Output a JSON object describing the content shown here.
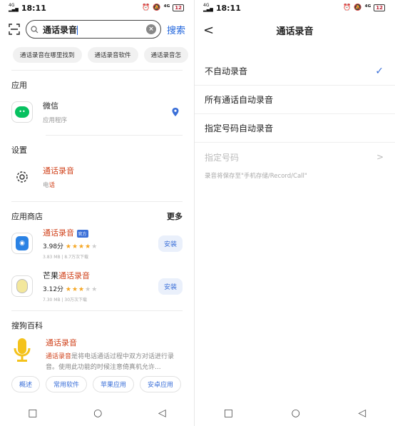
{
  "left": {
    "status": {
      "time": "18:11",
      "signal": "4G",
      "alarm_icon": "alarm-icon",
      "battery": "12"
    },
    "search": {
      "query": "通话录音",
      "clear_label": "×",
      "search_label": "搜索"
    },
    "chips": [
      "通话录音在哪里找到",
      "通话录音软件",
      "通话录音怎"
    ],
    "apps_section": {
      "title": "应用",
      "item": {
        "name": "微信",
        "sub": "应用程序"
      }
    },
    "settings_section": {
      "title": "设置",
      "item": {
        "name": "通话录音",
        "sub_prefix": "电",
        "sub_highlight": "话"
      }
    },
    "store_section": {
      "title": "应用商店",
      "more": "更多",
      "items": [
        {
          "name_plain": "",
          "name_highlight": "通话录音",
          "badge": "官方",
          "rating": "3.98分",
          "stars_on": "★★★★",
          "stars_off": "★",
          "meta": "3.83 MB | 8.7万次下载",
          "install": "安装"
        },
        {
          "name_plain": "芒果",
          "name_highlight": "通话录音",
          "badge": "",
          "rating": "3.12分",
          "stars_on": "★★★",
          "stars_off": "★★",
          "meta": "7.30 MB | 30万次下载",
          "install": "安装"
        }
      ]
    },
    "baike_section": {
      "title": "搜狗百科",
      "entry_title": "通话录音",
      "desc_highlight": "通话录音",
      "desc": "是将电话通话过程中双方对话进行录音。使用此功能的时候注意倚真机允许...",
      "buttons": [
        "概述",
        "常用软件",
        "苹果应用",
        "安卓应用"
      ]
    },
    "nav": {
      "back": "◁",
      "home": "○",
      "recent": "□"
    }
  },
  "right": {
    "status": {
      "time": "18:11",
      "battery": "12"
    },
    "back_label": "<",
    "title": "通话录音",
    "options": [
      {
        "label": "不自动录音",
        "checked": "✓"
      },
      {
        "label": "所有通话自动录音",
        "checked": ""
      },
      {
        "label": "指定号码自动录音",
        "checked": ""
      }
    ],
    "disabled_option": {
      "label": "指定号码",
      "chevron": ">"
    },
    "note": "录音将保存至\"手机存储/Record/Call\"",
    "nav": {
      "back": "◁",
      "home": "○",
      "recent": "□"
    }
  },
  "colors": {
    "accent": "#3a6fd8",
    "highlight": "#d0421b",
    "wechat": "#07c160"
  }
}
